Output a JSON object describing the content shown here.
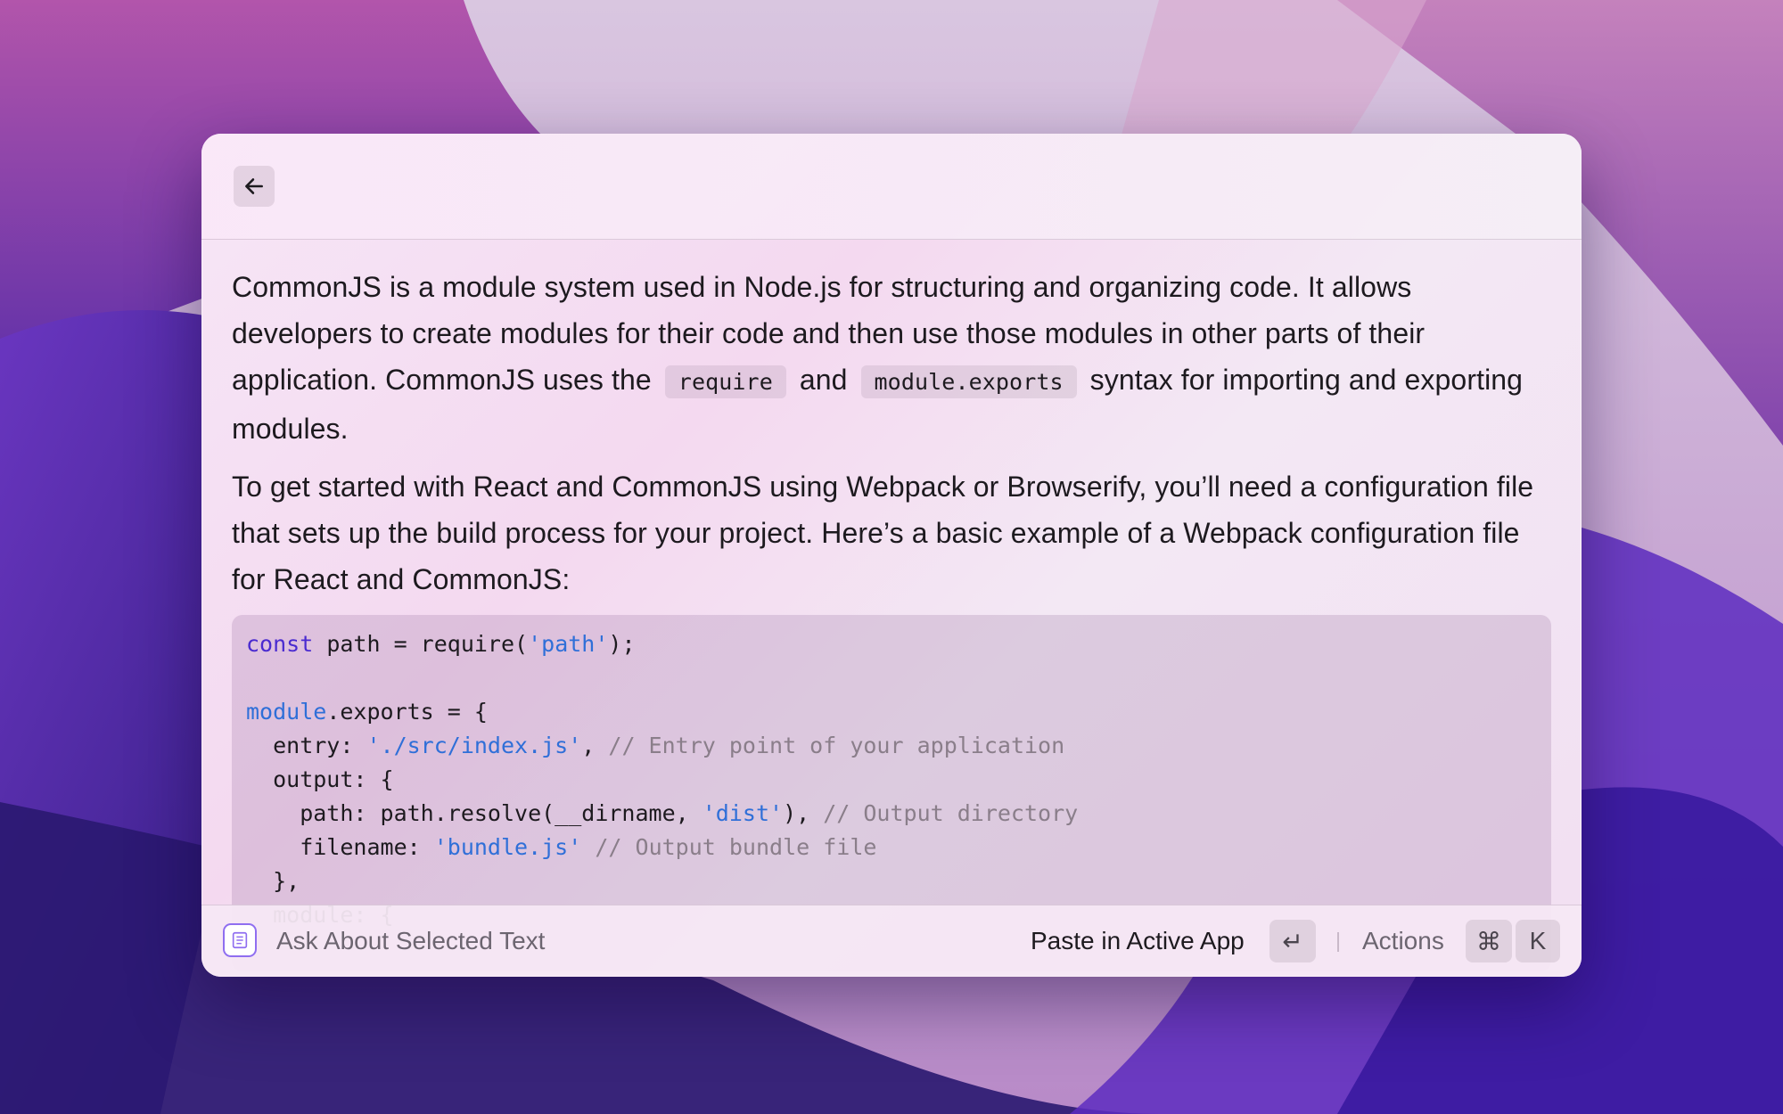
{
  "header": {
    "back_icon": "arrow-left-icon"
  },
  "content": {
    "paragraph1": {
      "before": "CommonJS is a module system used in Node.js for structuring and organizing code. It allows developers to create modules for their code and then use those modules in other parts of their application. CommonJS uses the ",
      "code1": "require",
      "middle": " and ",
      "code2": "module.exports",
      "after": " syntax for importing and exporting modules."
    },
    "paragraph2": "To get started with React and CommonJS using Webpack or Browserify, you’ll need a configuration file that sets up the build process for your project. Here’s a basic example of a Webpack configuration file for React and CommonJS:",
    "code_lines": [
      "const path = require('path');",
      "",
      "module.exports = {",
      "  entry: './src/index.js', // Entry point of your application",
      "  output: {",
      "    path: path.resolve(__dirname, 'dist'), // Output directory",
      "    filename: 'bundle.js' // Output bundle file",
      "  },",
      "  module: {"
    ]
  },
  "footer": {
    "icon": "notes-icon",
    "title": "Ask About Selected Text",
    "primary_action": "Paste in Active App",
    "enter_key": "↵",
    "actions_label": "Actions",
    "cmd_key": "⌘",
    "k_key": "K"
  },
  "colors": {
    "keyword": "#4a2bd0",
    "string": "#2f6fd8",
    "comment": "#8a7e8a",
    "accent": "#8f6ef0"
  }
}
